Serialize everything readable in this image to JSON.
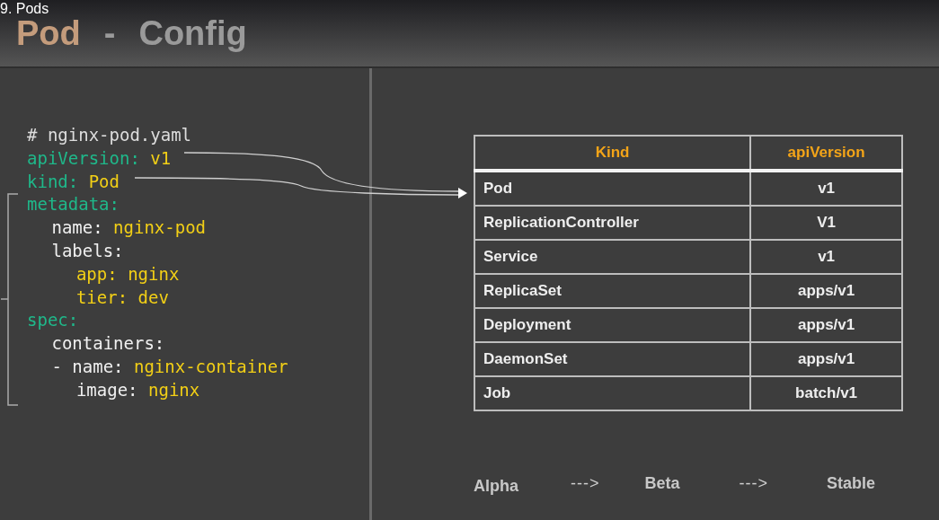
{
  "video_title": "9. Pods",
  "slide_title": [
    {
      "text": "Pod",
      "kind": "accent"
    },
    {
      "text": "-",
      "kind": "plain"
    },
    {
      "text": "Config",
      "kind": "plain"
    }
  ],
  "code": [
    {
      "kind": "comment",
      "key": "# nginx-pod.yaml"
    },
    {
      "kind": "top",
      "key": "apiVersion:",
      "value": "v1"
    },
    {
      "kind": "top",
      "key": "kind:",
      "value": "Pod"
    },
    {
      "kind": "top",
      "key": "metadata:",
      "children": [
        {
          "kind": "field",
          "key": "name:",
          "value": "nginx-pod"
        },
        {
          "kind": "field",
          "key": "labels:",
          "children": [
            {
              "kind": "label",
              "key": "app:",
              "value": "nginx"
            },
            {
              "kind": "label",
              "key": "tier:",
              "value": "dev"
            }
          ]
        }
      ]
    },
    {
      "kind": "top",
      "key": "spec:",
      "children": [
        {
          "kind": "field",
          "key": "containers:"
        },
        {
          "kind": "field",
          "key": "- name:",
          "value": "nginx-container",
          "children": [
            {
              "kind": "field",
              "key": "image:",
              "value": "nginx"
            }
          ]
        }
      ]
    }
  ],
  "table": {
    "columns": [
      "Kind",
      "apiVersion"
    ],
    "rows": [
      [
        "Pod",
        "v1"
      ],
      [
        "ReplicationController",
        "V1"
      ],
      [
        "Service",
        "v1"
      ],
      [
        "ReplicaSet",
        "apps/v1"
      ],
      [
        "Deployment",
        "apps/v1"
      ],
      [
        "DaemonSet",
        "apps/v1"
      ],
      [
        "Job",
        "batch/v1"
      ]
    ]
  },
  "maturity": [
    {
      "kind": "stage",
      "text": "Alpha"
    },
    {
      "kind": "arrow",
      "text": "--->"
    },
    {
      "kind": "stage",
      "text": "Beta"
    },
    {
      "kind": "arrow",
      "text": "--->"
    },
    {
      "kind": "stage",
      "text": "Stable"
    }
  ]
}
